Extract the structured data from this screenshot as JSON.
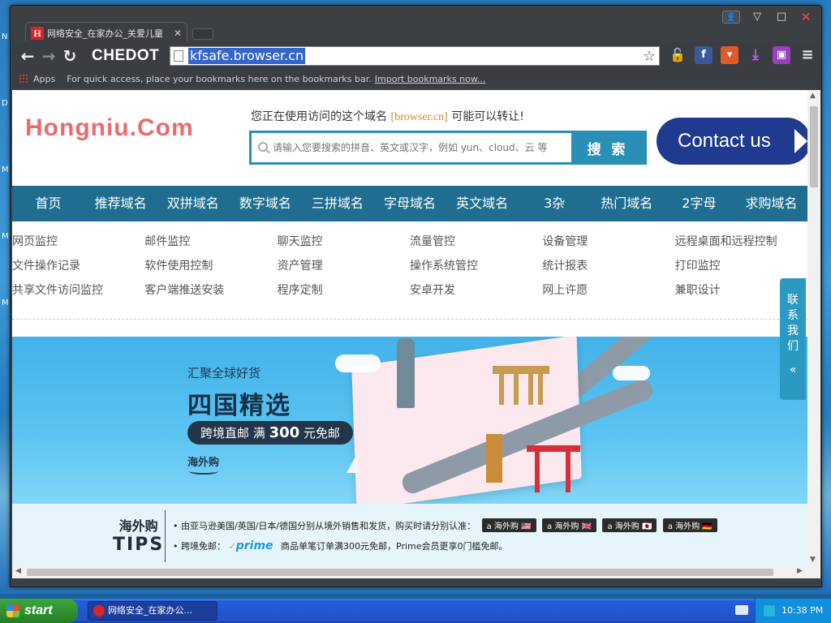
{
  "browser": {
    "tab_title": "网络安全_在家办公_关爱儿童",
    "tab_favicon_letter": "H",
    "brand": "CHEDOT",
    "url": "kfsafe.browser.cn",
    "bookmarks": {
      "apps_label": "Apps",
      "hint": "For quick access, place your bookmarks here on the bookmarks bar.",
      "import_link": "Import bookmarks now..."
    }
  },
  "site": {
    "logo": "Hongniu.Com",
    "notice_prefix": "您正在使用访问的这个域名",
    "notice_domain": "[browser.cn]",
    "notice_suffix": "可能可以转让!",
    "search_placeholder": "请输入您要搜索的拼音、英文或汉字，例如 yun、cloud、云 等",
    "search_button": "搜 索",
    "contact_label": "Contact us",
    "nav": [
      "首页",
      "推荐域名",
      "双拼域名",
      "数字域名",
      "三拼域名",
      "字母域名",
      "英文域名",
      "3杂",
      "热门域名",
      "2字母",
      "求购域名"
    ],
    "links": [
      [
        "网页监控",
        "邮件监控",
        "聊天监控",
        "流量管控",
        "设备管理",
        "远程桌面和远程控制"
      ],
      [
        "文件操作记录",
        "软件使用控制",
        "资产管理",
        "操作系统管控",
        "统计报表",
        "打印监控"
      ],
      [
        "共享文件访问监控",
        "客户端推送安装",
        "程序定制",
        "安卓开发",
        "网上许愿",
        "兼职设计"
      ]
    ],
    "side_float": [
      "联",
      "系",
      "我",
      "们"
    ]
  },
  "banner": {
    "subtitle": "汇聚全球好货",
    "title": "四国精选",
    "pill_prefix": "跨境直邮 满",
    "pill_amount": "300",
    "pill_suffix": "元免邮",
    "brand": "海外购"
  },
  "tips": {
    "logo_top": "海外购",
    "logo_bottom": "TIPS",
    "tip1": "• 由亚马逊美国/英国/日本/德国分别从境外销售和发货，购买时请分别认准：",
    "badges": [
      "a 海外购 🇺🇸",
      "a 海外购 🇬🇧",
      "a 海外购 🇯🇵",
      "a 海外购 🇩🇪"
    ],
    "tip2_prefix": "• 跨境免邮：",
    "prime_label": "prime",
    "tip2_suffix": "商品单笔订单满300元免邮，Prime会员更享0门槛免邮。"
  },
  "taskbar": {
    "start_label": "start",
    "task_title": "网络安全_在家办公...",
    "clock": "10:38 PM"
  }
}
